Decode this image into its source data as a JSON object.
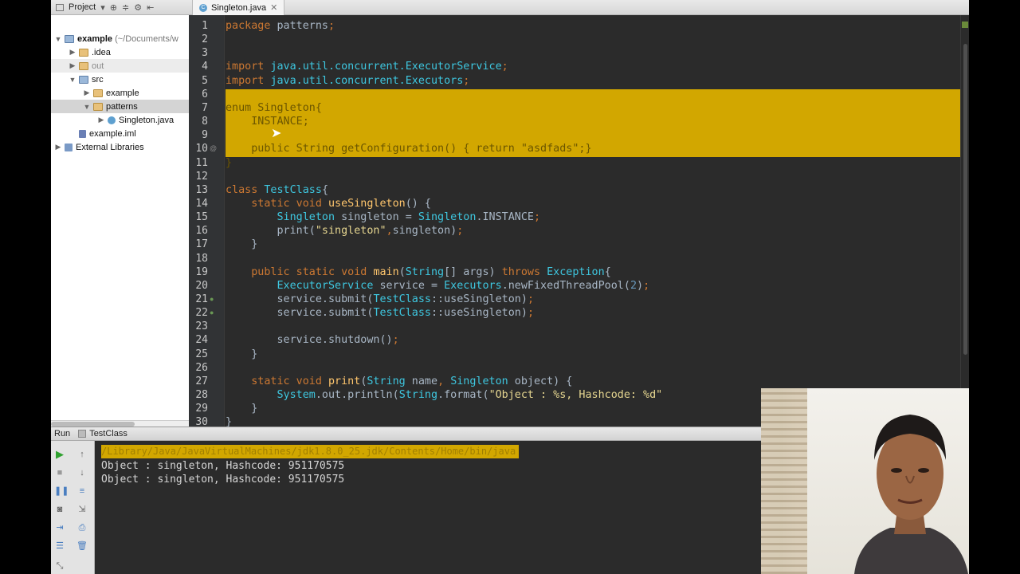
{
  "project_panel": {
    "title": "Project",
    "tree": [
      {
        "label": "example",
        "suffix": "(~/Documents/w",
        "depth": 0,
        "arrow": "▼",
        "icon": "folder-src",
        "bold": true
      },
      {
        "label": ".idea",
        "depth": 1,
        "arrow": "▶",
        "icon": "folder"
      },
      {
        "label": "out",
        "depth": 1,
        "arrow": "▶",
        "icon": "folder",
        "dim": true
      },
      {
        "label": "src",
        "depth": 1,
        "arrow": "▼",
        "icon": "folder-src"
      },
      {
        "label": "example",
        "depth": 2,
        "arrow": "▶",
        "icon": "folder"
      },
      {
        "label": "patterns",
        "depth": 2,
        "arrow": "▼",
        "icon": "folder",
        "selected": true
      },
      {
        "label": "Singleton.java",
        "depth": 3,
        "arrow": "▶",
        "icon": "java"
      },
      {
        "label": "example.iml",
        "depth": 1,
        "arrow": "",
        "icon": "iml"
      },
      {
        "label": "External Libraries",
        "depth": 0,
        "arrow": "▶",
        "icon": "lib"
      }
    ]
  },
  "editor": {
    "tab_label": "Singleton.java",
    "lines": [
      {
        "n": "1",
        "html": "<span class=\"kw\">package </span>patterns<span class=\"kw\">;</span>"
      },
      {
        "n": "2",
        "html": ""
      },
      {
        "n": "3",
        "html": ""
      },
      {
        "n": "4",
        "html": "<span class=\"kw\">import </span><span class=\"cls\">java.util.concurrent.ExecutorService</span><span class=\"kw\">;</span>"
      },
      {
        "n": "5",
        "html": "<span class=\"kw\">import </span><span class=\"cls\">java.util.concurrent.Executors</span><span class=\"kw\">;</span>"
      },
      {
        "n": "6",
        "html": "",
        "hl": true
      },
      {
        "n": "7",
        "html": "enum Singleton{",
        "hl": true
      },
      {
        "n": "8",
        "html": "    INSTANCE;",
        "hl": true
      },
      {
        "n": "9",
        "html": "",
        "hl": true
      },
      {
        "n": "10",
        "html": "    public String getConfiguration() { return \"asdfads\";}",
        "hl": true,
        "mark": "@"
      },
      {
        "n": "11",
        "html": "}",
        "hl": true
      },
      {
        "n": "12",
        "html": ""
      },
      {
        "n": "13",
        "html": "<span class=\"kw\">class </span><span class=\"cls\">TestClass</span>{"
      },
      {
        "n": "14",
        "html": "    <span class=\"kw\">static void </span><span class=\"fn\">useSingleton</span>() {"
      },
      {
        "n": "15",
        "html": "        <span class=\"cls\">Singleton</span> singleton = <span class=\"cls\">Singleton</span>.INSTANCE<span class=\"kw\">;</span>"
      },
      {
        "n": "16",
        "html": "        print(<span class=\"str\">\"singleton\"</span><span class=\"kw\">,</span>singleton)<span class=\"kw\">;</span>"
      },
      {
        "n": "17",
        "html": "    }"
      },
      {
        "n": "18",
        "html": ""
      },
      {
        "n": "19",
        "html": "    <span class=\"kw\">public static void </span><span class=\"fn\">main</span>(<span class=\"cls\">String</span>[] args) <span class=\"kw\">throws </span><span class=\"cls\">Exception</span>{"
      },
      {
        "n": "20",
        "html": "        <span class=\"cls\">ExecutorService</span> service = <span class=\"cls\">Executors</span>.newFixedThreadPool(<span class=\"num\">2</span>)<span class=\"kw\">;</span>"
      },
      {
        "n": "21",
        "html": "        service.submit(<span class=\"cls\">TestClass</span>::useSingleton)<span class=\"kw\">;</span>",
        "mark": "●"
      },
      {
        "n": "22",
        "html": "        service.submit(<span class=\"cls\">TestClass</span>::useSingleton)<span class=\"kw\">;</span>",
        "mark": "●"
      },
      {
        "n": "23",
        "html": ""
      },
      {
        "n": "24",
        "html": "        service.shutdown()<span class=\"kw\">;</span>"
      },
      {
        "n": "25",
        "html": "    }"
      },
      {
        "n": "26",
        "html": ""
      },
      {
        "n": "27",
        "html": "    <span class=\"kw\">static void </span><span class=\"fn\">print</span>(<span class=\"cls\">String</span> name<span class=\"kw\">, </span><span class=\"cls\">Singleton</span> object) {"
      },
      {
        "n": "28",
        "html": "        <span class=\"cls\">System</span>.out.println(<span class=\"cls\">String</span>.format(<span class=\"str\">\"Object : %s, Hashcode: %d\"</span>"
      },
      {
        "n": "29",
        "html": "    }"
      },
      {
        "n": "30",
        "html": "}"
      }
    ]
  },
  "run_panel": {
    "run_label": "Run",
    "config_label": "TestClass",
    "command_line": "/Library/Java/JavaVirtualMachines/jdk1.8.0_25.jdk/Contents/Home/bin/java",
    "output": [
      "Object : singleton, Hashcode: 951170575",
      "Object : singleton, Hashcode: 951170575"
    ]
  }
}
